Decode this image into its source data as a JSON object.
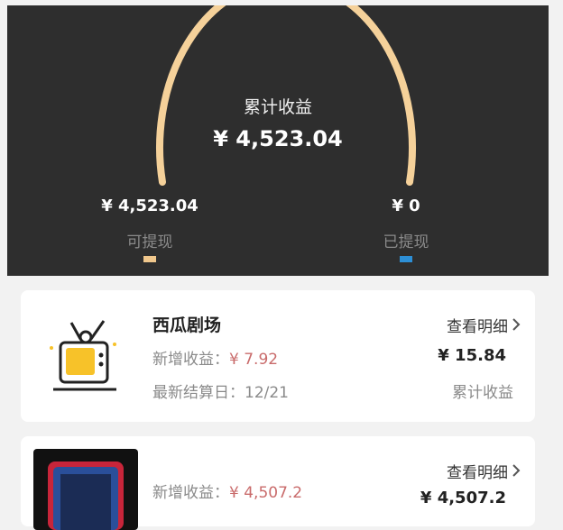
{
  "summary": {
    "title": "累计收益",
    "total": "¥ 4,523.04",
    "withdrawable": {
      "value": "¥ 4,523.04",
      "label": "可提现",
      "color": "#f0c78c"
    },
    "withdrawn": {
      "value": "¥ 0",
      "label": "已提现",
      "color": "#2d8fd6"
    },
    "arc_color": "#f5d19a"
  },
  "cards": [
    {
      "title": "西瓜剧场",
      "new_income_label": "新增收益：",
      "new_income_value": "¥ 7.92",
      "settle_label": "最新结算日：",
      "settle_value": "12/21",
      "detail_label": "查看明细",
      "total": "¥ 15.84",
      "total_label": "累计收益",
      "icon": "tv-icon"
    },
    {
      "title": "",
      "new_income_label": "新增收益：",
      "new_income_value": "¥ 4,507.2",
      "detail_label": "查看明细",
      "total": "¥ 4,507.2",
      "icon": "phone-icon"
    }
  ]
}
